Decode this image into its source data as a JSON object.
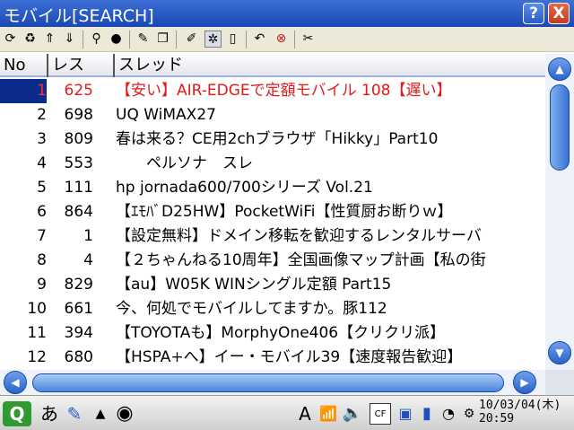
{
  "window": {
    "title": "モバイル[SEARCH]",
    "help_label": "?",
    "close_label": "X"
  },
  "toolbar": {
    "icons": [
      "refresh-icon",
      "reload-icon",
      "up-icon",
      "down-icon",
      "search-icon",
      "globe-icon",
      "edit-icon",
      "copy-icon",
      "pin-icon",
      "wand-icon",
      "trash-icon",
      "undo-icon",
      "stop-icon",
      "settings-icon"
    ],
    "selected": "wand-icon"
  },
  "columns": {
    "no": "No",
    "res": "レス",
    "thread": "スレッド"
  },
  "rows": [
    {
      "no": "1",
      "res": "625",
      "thread": "【安い】AIR-EDGEで定額モバイル 108【遅い】"
    },
    {
      "no": "2",
      "res": "698",
      "thread": "UQ WiMAX27"
    },
    {
      "no": "3",
      "res": "809",
      "thread": "春は来る？CE用2chブラウザ「Hikky」Part10"
    },
    {
      "no": "4",
      "res": "553",
      "thread": "　　ペルソナ　スレ"
    },
    {
      "no": "5",
      "res": "111",
      "thread": "hp jornada600/700シリーズ Vol.21"
    },
    {
      "no": "6",
      "res": "864",
      "thread": "【ｴﾓﾊﾞD25HW】PocketWiFi【性質厨お断りｗ】"
    },
    {
      "no": "7",
      "res": "1",
      "thread": "【設定無料】ドメイン移転を歓迎するレンタルサーバ"
    },
    {
      "no": "8",
      "res": "4",
      "thread": "【２ちゃんねる10周年】全国画像マップ計画【私の街"
    },
    {
      "no": "9",
      "res": "829",
      "thread": "【au】W05K WINシングル定額 Part15"
    },
    {
      "no": "10",
      "res": "661",
      "thread": "今、何処でモバイルしてますか。豚112"
    },
    {
      "no": "11",
      "res": "394",
      "thread": "【TOYOTAも】MorphyOne406【クリクリ派】"
    },
    {
      "no": "12",
      "res": "680",
      "thread": "【HSPA+へ】イー・モバイル39【速度報告歓迎】"
    }
  ],
  "selected_row": "1",
  "hot_row": "1",
  "scrollbars": {
    "up_label": "▲",
    "down_label": "▼",
    "left_label": "◀",
    "right_label": "▶"
  },
  "taskbar": {
    "q_label": "Q",
    "ime_label": "あ",
    "up_arrow": "▲",
    "date": "10/03/04(木)",
    "time": "20:59"
  },
  "colors": {
    "title_bar": "#2456c4",
    "selection": "#0a2a8c",
    "hot_text": "#e41a1a"
  }
}
